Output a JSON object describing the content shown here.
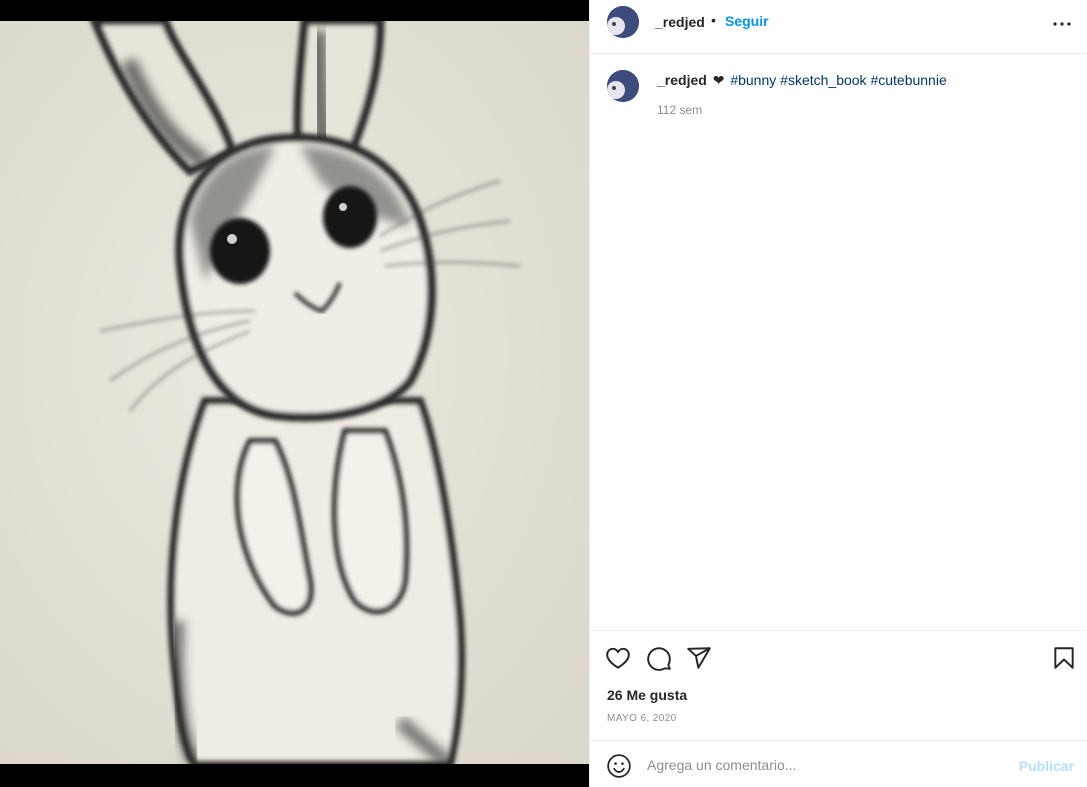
{
  "post": {
    "image_alt": "Pencil sketch of a standing bunny",
    "username": "_redjed",
    "separator": "•",
    "follow_label": "Seguir",
    "caption": {
      "username": "_redjed",
      "heart": "❤",
      "hashtags": [
        "#bunny",
        "#sketch_book",
        "#cutebunnie"
      ]
    },
    "time_ago": "112 sem",
    "likes_label": "26 Me gusta",
    "date_label": "MAYO 6, 2020"
  },
  "icons": {
    "more": "more-options-icon",
    "like": "heart-icon",
    "comment": "comment-icon",
    "share": "paper-plane-icon",
    "save": "bookmark-icon",
    "emoji": "emoji-icon"
  },
  "comment_box": {
    "placeholder": "Agrega un comentario...",
    "value": "",
    "publish_label": "Publicar"
  },
  "colors": {
    "accent": "#0095f6",
    "hashtag": "#00376b",
    "muted": "#8e8e8e",
    "publish_disabled": "#b2dffc"
  }
}
